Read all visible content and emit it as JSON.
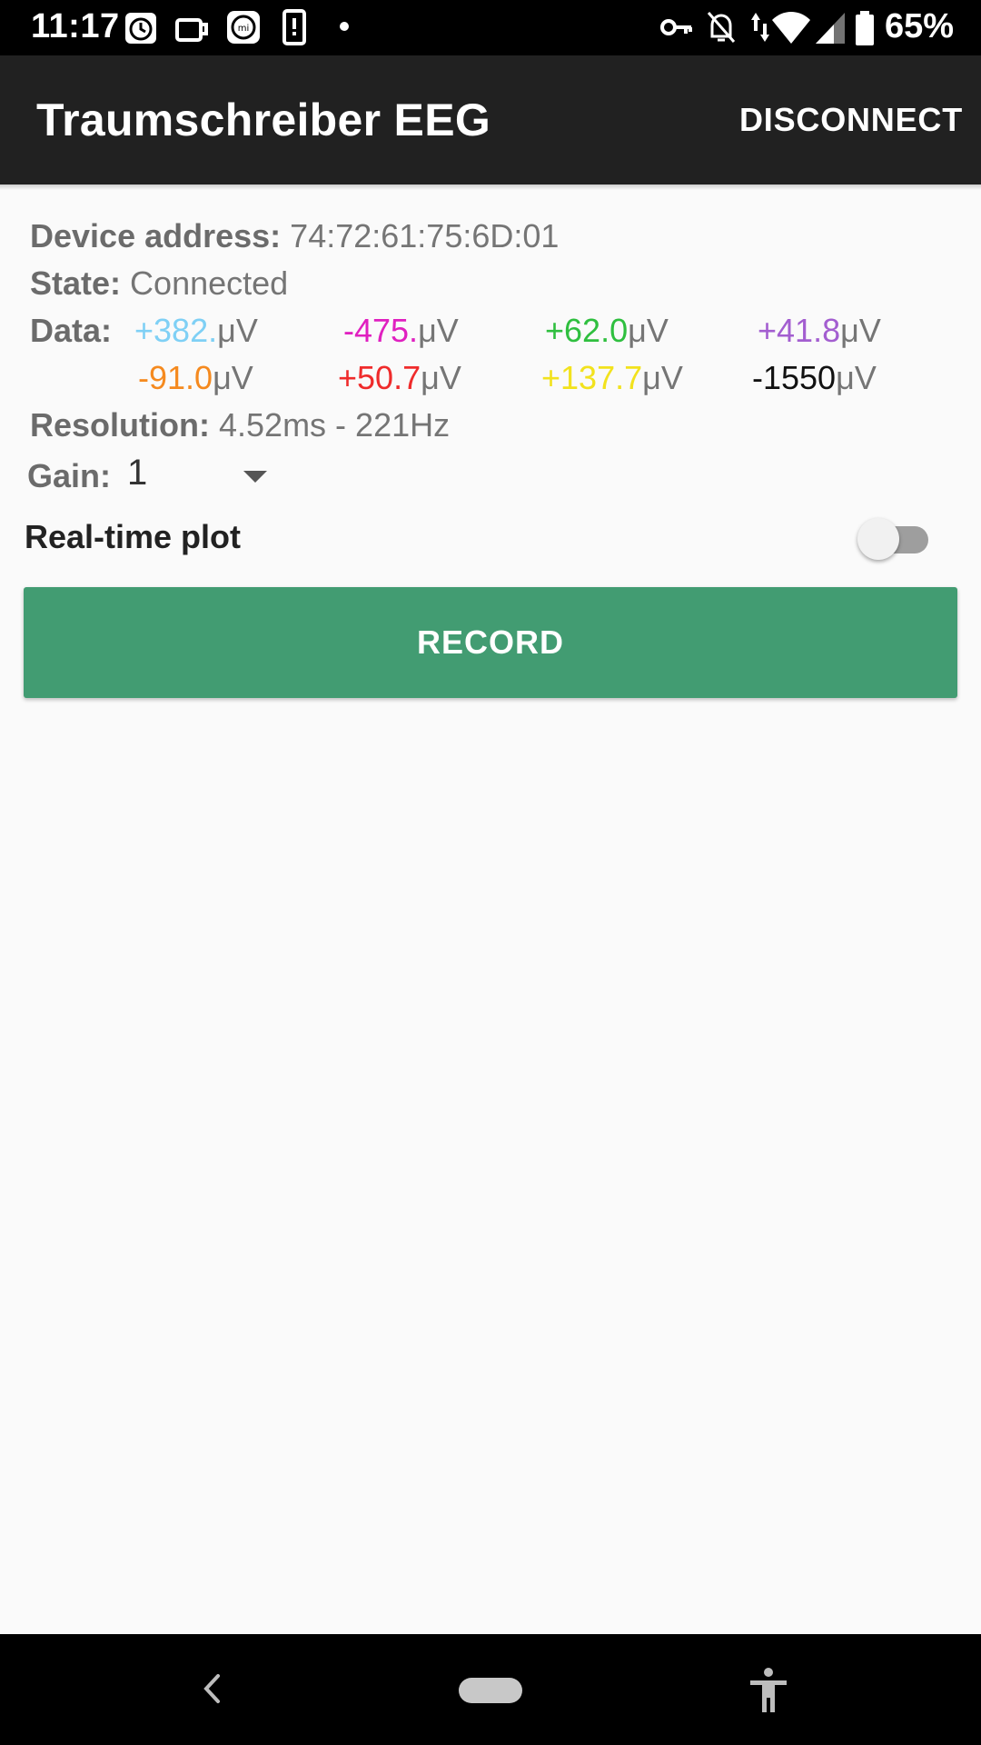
{
  "status_bar": {
    "time": "11:17",
    "battery": "65%",
    "left_icons": [
      "clock-icon",
      "cup-icon",
      "mi-fit-icon",
      "phone-alert-icon",
      "dot-icon"
    ],
    "right_icons": [
      "vpn-key-icon",
      "notifications-off-icon",
      "wifi-icon",
      "cell-signal-icon",
      "battery-icon"
    ]
  },
  "app_bar": {
    "title": "Traumschreiber EEG",
    "action_label": "DISCONNECT"
  },
  "info": {
    "device_label": "Device address:",
    "device_value": "74:72:61:75:6D:01",
    "state_label": "State:",
    "state_value": "Connected",
    "data_label": "Data:",
    "resolution_label": "Resolution:",
    "resolution_value": "4.52ms - 221Hz"
  },
  "data_values": [
    {
      "value": "+382.",
      "unit": "μV",
      "color": "#7fd0f5"
    },
    {
      "value": "-475.",
      "unit": "μV",
      "color": "#e020c0"
    },
    {
      "value": "+62.0",
      "unit": "μV",
      "color": "#2fbf3f"
    },
    {
      "value": "+41.8",
      "unit": "μV",
      "color": "#a35ed0"
    },
    {
      "value": "-91.0",
      "unit": "μV",
      "color": "#f58a1f"
    },
    {
      "value": "+50.7",
      "unit": "μV",
      "color": "#ef2b2b"
    },
    {
      "value": "+137.7",
      "unit": "μV",
      "color": "#f2e21d"
    },
    {
      "value": "-1550",
      "unit": "μV",
      "color": "#111111"
    }
  ],
  "gain": {
    "label": "Gain:",
    "selected": "1"
  },
  "realtime_plot": {
    "label": "Real-time plot",
    "enabled": false
  },
  "record_button": {
    "label": "RECORD",
    "color": "#429c72"
  }
}
